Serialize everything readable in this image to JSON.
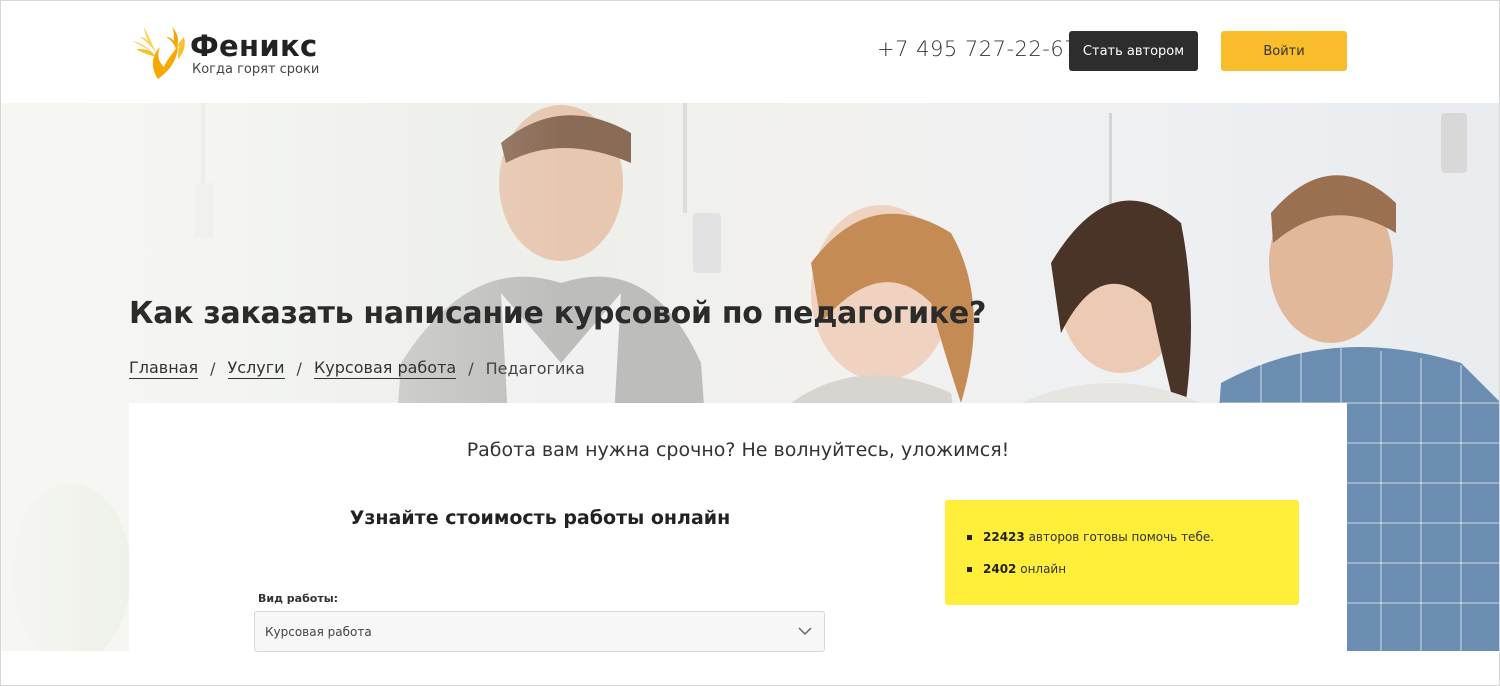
{
  "header": {
    "logo_name": "Феникс",
    "logo_tagline": "Когда горят сроки",
    "phone": "+7 495 727-22-67",
    "become_author_label": "Стать автором",
    "login_label": "Войти"
  },
  "hero": {
    "title": "Как заказать написание курсовой по педагогике?",
    "breadcrumbs": [
      {
        "label": "Главная"
      },
      {
        "label": "Услуги"
      },
      {
        "label": "Курсовая работа"
      },
      {
        "label": "Педагогика"
      }
    ],
    "separator": "/"
  },
  "card": {
    "slogan": "Работа вам нужна срочно? Не волнуйтесь, уложимся!",
    "heading": "Узнайте стоимость работы онлайн",
    "work_type_label": "Вид работы:",
    "work_type_value": "Курсовая работа",
    "stats": [
      {
        "number": "22423",
        "text": " авторов готовы помочь тебе."
      },
      {
        "number": "2402",
        "text": " онлайн"
      }
    ]
  },
  "colors": {
    "accent_yellow": "#f9bd2c",
    "stats_yellow": "#ffee3a",
    "dark_button": "#2d2d2d"
  },
  "icons": {
    "logo": "phoenix-logo-icon",
    "select_arrow": "chevron-down-icon"
  }
}
